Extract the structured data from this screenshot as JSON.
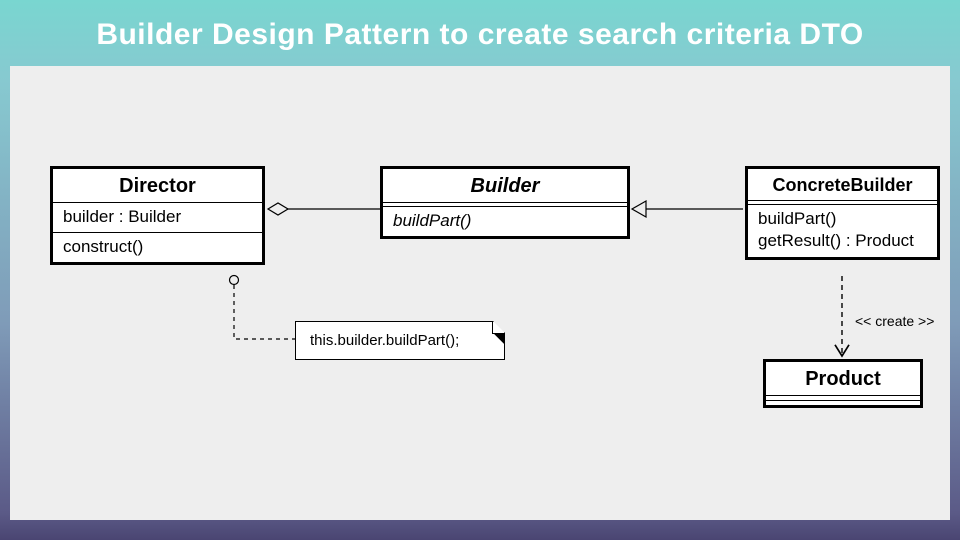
{
  "title": "Builder Design Pattern to create search criteria DTO",
  "diagram": {
    "classes": {
      "director": {
        "name": "Director",
        "attributes": [
          "builder : Builder"
        ],
        "operations": [
          "construct()"
        ]
      },
      "builder": {
        "name": "Builder",
        "abstract": true,
        "operations": [
          "buildPart()"
        ]
      },
      "concreteBuilder": {
        "name": "ConcreteBuilder",
        "operations": [
          "buildPart()",
          "getResult() : Product"
        ]
      },
      "product": {
        "name": "Product"
      }
    },
    "note": "this.builder.buildPart();",
    "stereotype": "<< create >>",
    "relations": [
      {
        "from": "Director",
        "to": "Builder",
        "type": "aggregation"
      },
      {
        "from": "ConcreteBuilder",
        "to": "Builder",
        "type": "realization"
      },
      {
        "from": "ConcreteBuilder",
        "to": "Product",
        "type": "dependency",
        "stereotype": "create"
      },
      {
        "from": "Director.construct",
        "to": "Note",
        "type": "note-anchor"
      }
    ]
  },
  "chart_data": {
    "type": "uml-class-diagram",
    "nodes": [
      {
        "id": "Director",
        "kind": "class",
        "attributes": [
          "builder : Builder"
        ],
        "operations": [
          "construct()"
        ]
      },
      {
        "id": "Builder",
        "kind": "abstract-class",
        "operations": [
          "buildPart()"
        ]
      },
      {
        "id": "ConcreteBuilder",
        "kind": "class",
        "operations": [
          "buildPart()",
          "getResult() : Product"
        ]
      },
      {
        "id": "Product",
        "kind": "class"
      },
      {
        "id": "Note1",
        "kind": "note",
        "text": "this.builder.buildPart();"
      }
    ],
    "edges": [
      {
        "from": "Director",
        "to": "Builder",
        "type": "aggregation-open-diamond"
      },
      {
        "from": "ConcreteBuilder",
        "to": "Builder",
        "type": "generalization-hollow-triangle"
      },
      {
        "from": "ConcreteBuilder",
        "to": "Product",
        "type": "dependency-dashed-open-arrow",
        "label": "<< create >>"
      },
      {
        "from": "Director",
        "to": "Note1",
        "type": "note-anchor-dashed",
        "anchor": "construct()"
      }
    ]
  }
}
